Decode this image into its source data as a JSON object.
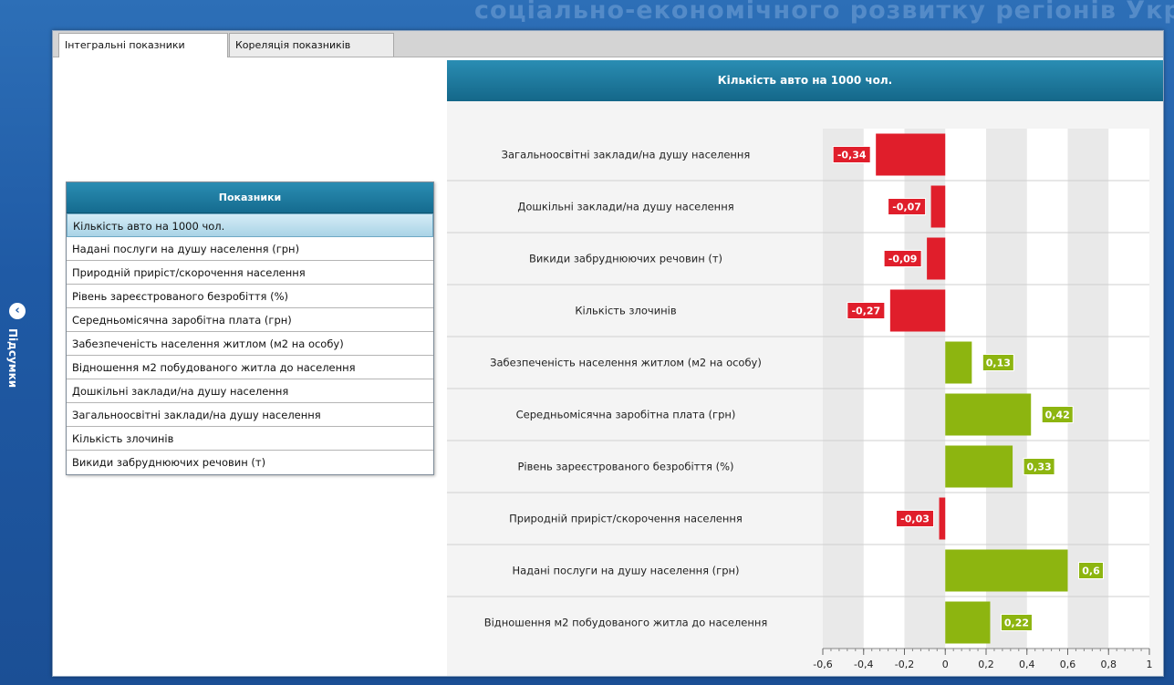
{
  "banner": {
    "text": "соціально-економічного розвитку регіонів Украї"
  },
  "side_panel": {
    "label": "Підсумки",
    "icon": "back-arrow-icon"
  },
  "tabs": [
    {
      "label": "Інтегральні показники"
    },
    {
      "label": "Кореляція показників"
    }
  ],
  "indicator_list": {
    "header": "Показники",
    "items": [
      "Кількість авто на 1000 чол.",
      "Надані послуги на душу населення (грн)",
      "Природній приріст/скорочення населення",
      "Рівень зареєстрованого безробіття (%)",
      "Середньомісячна заробітна плата (грн)",
      "Забезпеченість населення житлом (м2 на особу)",
      "Відношення м2 побудованого житла до населення",
      "Дошкільні заклади/на душу населення",
      "Загальноосвітні заклади/на душу населення",
      "Кількість злочинів",
      "Викиди забруднюючих речовин (т)"
    ],
    "selected_index": 0
  },
  "colors": {
    "negative": "#e01e2b",
    "positive": "#8db510",
    "header_blue": "#1a7aa2"
  },
  "chart_data": {
    "type": "bar",
    "orientation": "horizontal",
    "title": "Кількість авто на 1000 чол.",
    "categories": [
      "Загальноосвітні заклади/на душу населення",
      "Дошкільні заклади/на душу населення",
      "Викиди забруднюючих речовин (т)",
      "Кількість злочинів",
      "Забезпеченість населення житлом (м2 на особу)",
      "Середньомісячна заробітна плата (грн)",
      "Рівень зареєстрованого безробіття (%)",
      "Природній приріст/скорочення населення",
      "Надані послуги на душу населення (грн)",
      "Відношення м2 побудованого житла до населення"
    ],
    "values": [
      -0.34,
      -0.07,
      -0.09,
      -0.27,
      0.13,
      0.42,
      0.33,
      -0.03,
      0.6,
      0.22
    ],
    "value_labels": [
      "-0,34",
      "-0,07",
      "-0,09",
      "-0,27",
      "0,13",
      "0,42",
      "0,33",
      "-0,03",
      "0,6",
      "0,22"
    ],
    "xlim": [
      -0.6,
      1
    ],
    "xticks": [
      -0.6,
      -0.4,
      -0.2,
      0,
      0.2,
      0.4,
      0.6,
      0.8,
      1
    ],
    "xtick_labels": [
      "-0,6",
      "-0,4",
      "-0,2",
      "0",
      "0,2",
      "0,4",
      "0,6",
      "0,8",
      "1"
    ],
    "grid": "alternating vertical bands",
    "legend": "none"
  }
}
